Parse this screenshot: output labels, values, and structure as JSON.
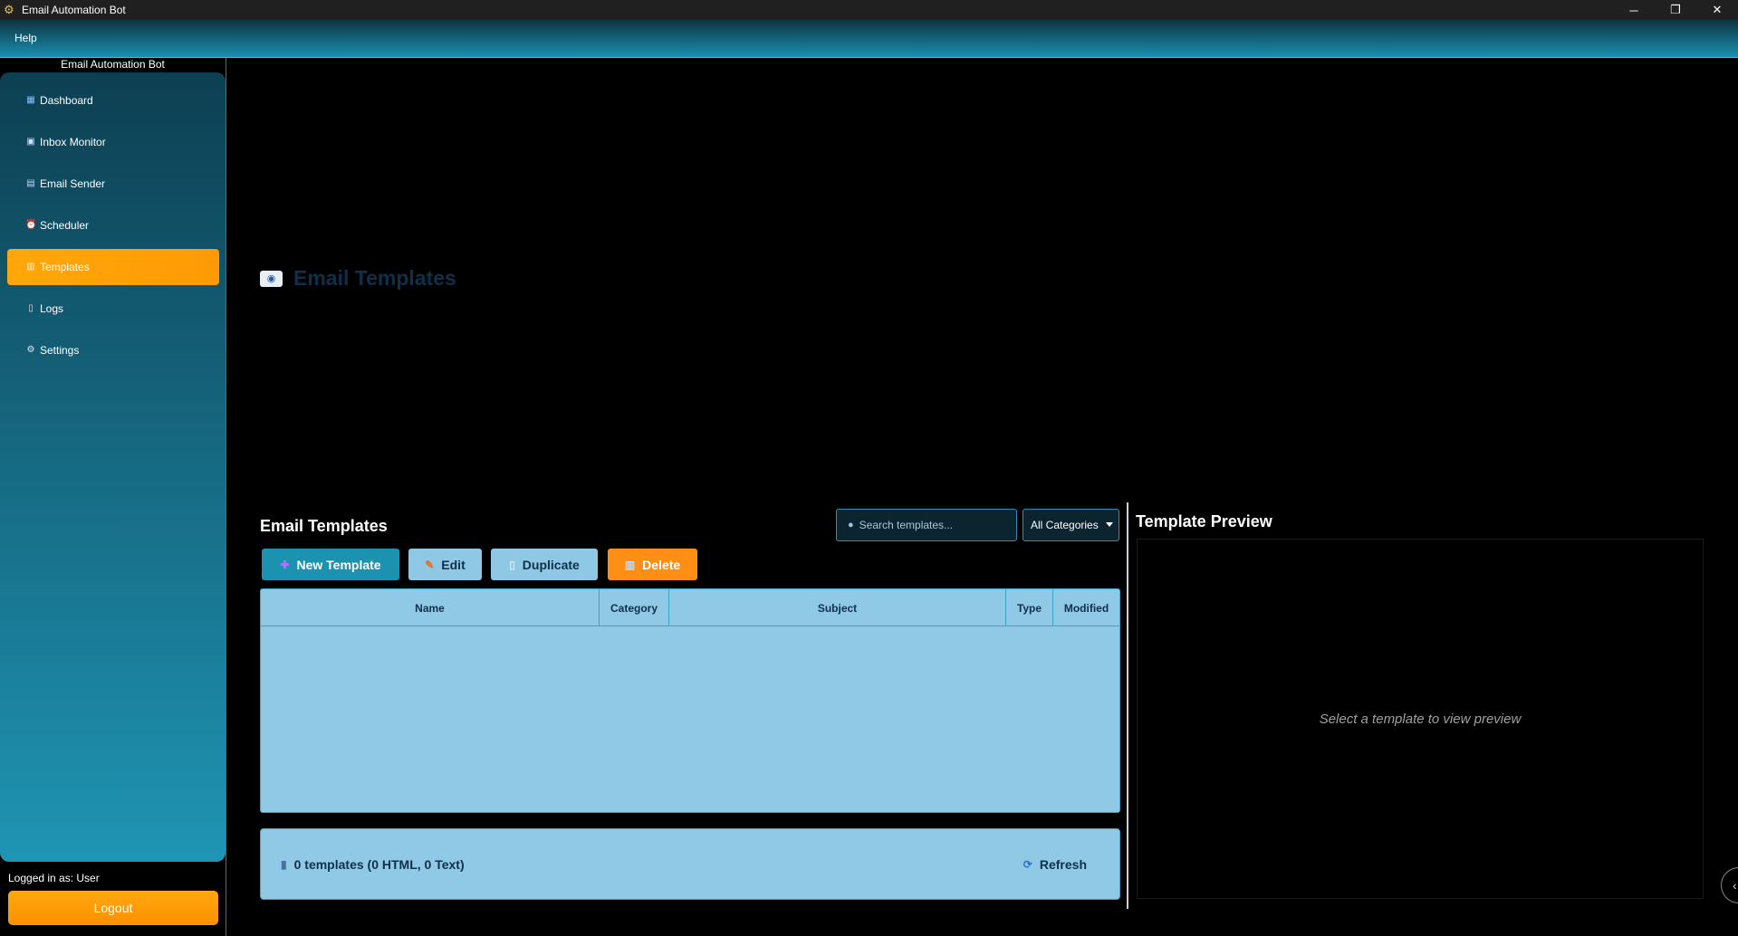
{
  "window": {
    "title": "Email Automation Bot",
    "app_icon": "gear-icon",
    "minimize": "─",
    "maximize": "❐",
    "close": "✕"
  },
  "menu": {
    "help": "Help"
  },
  "sidebar": {
    "title": "Email Automation Bot",
    "items": [
      {
        "label": "Dashboard",
        "icon": "chart-icon",
        "glyph": "▦",
        "active": false
      },
      {
        "label": "Inbox Monitor",
        "icon": "inbox-icon",
        "glyph": "▣",
        "active": false
      },
      {
        "label": "Email Sender",
        "icon": "sender-icon",
        "glyph": "▤",
        "active": false
      },
      {
        "label": "Scheduler",
        "icon": "alarm-clock-icon",
        "glyph": "⏰",
        "active": false
      },
      {
        "label": "Templates",
        "icon": "template-icon",
        "glyph": "▥",
        "active": true
      },
      {
        "label": "Logs",
        "icon": "clipboard-icon",
        "glyph": "▯",
        "active": false
      },
      {
        "label": "Settings",
        "icon": "gear-icon",
        "glyph": "⚙",
        "active": false
      }
    ],
    "logged_in": "Logged in as: User",
    "logout": "Logout"
  },
  "page": {
    "heading": "Email Templates",
    "heading_icon": "email-icon"
  },
  "templates": {
    "title": "Email Templates",
    "search_placeholder": "Search templates...",
    "category": "All Categories",
    "buttons": {
      "new": "New Template",
      "edit": "Edit",
      "duplicate": "Duplicate",
      "delete": "Delete"
    },
    "columns": [
      "Name",
      "Category",
      "Subject",
      "Type",
      "Modified"
    ],
    "rows": [],
    "status": "0 templates (0 HTML, 0 Text)",
    "refresh": "Refresh"
  },
  "preview": {
    "title": "Template Preview",
    "placeholder": "Select a template to view preview"
  },
  "colors": {
    "accent": "#ff9a05",
    "sidebar_top": "#0d3f52",
    "sidebar_bottom": "#1f95b4",
    "panel": "#8fc9e5",
    "primary_button": "#1a92b0"
  }
}
